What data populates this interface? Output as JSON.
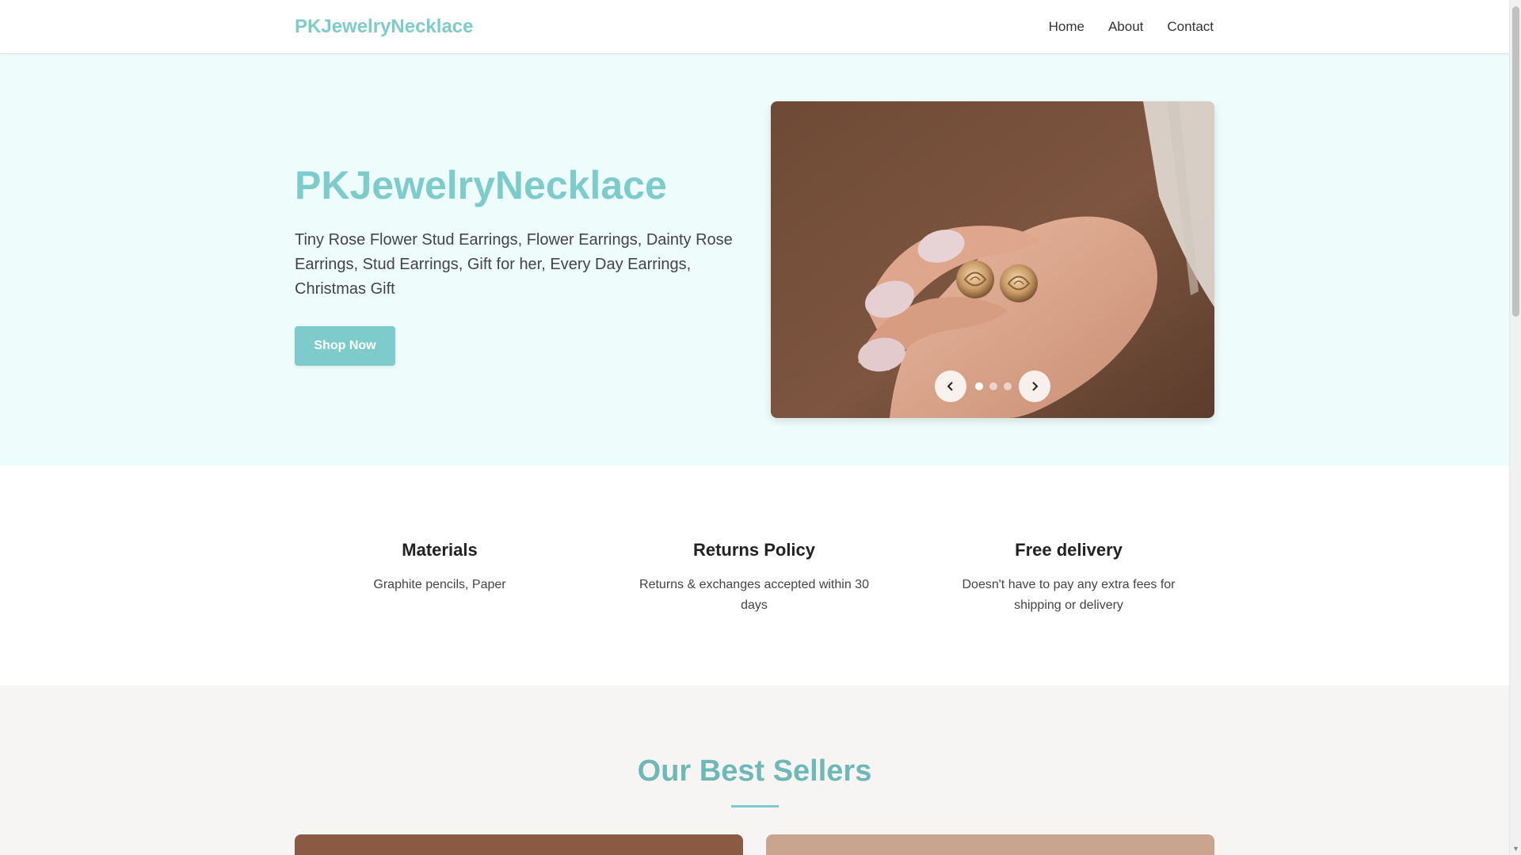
{
  "header": {
    "brand": "PKJewelryNecklace",
    "nav": [
      "Home",
      "About",
      "Contact"
    ]
  },
  "hero": {
    "title": "PKJewelryNecklace",
    "description": "Tiny Rose Flower Stud Earrings, Flower Earrings, Dainty Rose Earrings, Stud Earrings, Gift for her, Every Day Earrings, Christmas Gift",
    "cta_label": "Shop Now",
    "carousel": {
      "slide_count": 3,
      "active_slide": 1
    }
  },
  "features": [
    {
      "title": "Materials",
      "text": "Graphite pencils, Paper"
    },
    {
      "title": "Returns Policy",
      "text": "Returns & exchanges accepted within 30 days"
    },
    {
      "title": "Free delivery",
      "text": "Doesn't have to pay any extra fees for shipping or delivery"
    }
  ],
  "best_sellers": {
    "title": "Our Best Sellers"
  },
  "colors": {
    "accent": "#7ecbcb",
    "hero_bg": "#effcfc",
    "sellers_bg": "#f7f5f3"
  },
  "icons": [
    "chevron-left-icon",
    "chevron-right-icon"
  ]
}
